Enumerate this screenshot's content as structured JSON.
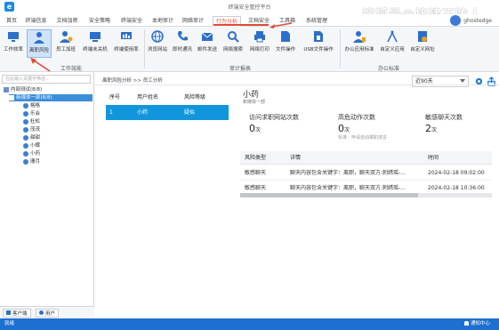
{
  "window": {
    "title": "终端安全管控平台",
    "logo_glyph": "e"
  },
  "watermark": "搜狐号@接建不防人",
  "menu": [
    {
      "label": "首页",
      "active": false
    },
    {
      "label": "终端信息",
      "active": false
    },
    {
      "label": "文档加密",
      "active": false
    },
    {
      "label": "安全策略",
      "active": false
    },
    {
      "label": "终端安全",
      "active": false
    },
    {
      "label": "本地审计",
      "active": false
    },
    {
      "label": "网络审计",
      "active": false
    },
    {
      "label": "行为分析",
      "active": true
    },
    {
      "label": "文档安全",
      "active": false
    },
    {
      "label": "工具箱",
      "active": false
    },
    {
      "label": "系统管理",
      "active": false
    }
  ],
  "user": {
    "name": "ghostedge"
  },
  "ribbon": {
    "groups": [
      {
        "label": "工作效能"
      },
      {
        "label": "审计报表"
      },
      {
        "label": "办公标准"
      }
    ],
    "buttons": [
      {
        "label": "工作效率",
        "icon": "monitor-icon",
        "selected": false
      },
      {
        "label": "离职风险",
        "icon": "person-risk-icon",
        "selected": true
      },
      {
        "label": "员工加班",
        "icon": "overtime-icon",
        "selected": false
      },
      {
        "label": "终端未关机",
        "icon": "terminal-icon",
        "selected": false
      },
      {
        "label": "终端使用率",
        "icon": "usage-icon",
        "selected": false
      },
      {
        "label": "浏览网站",
        "icon": "globe-icon",
        "selected": false
      },
      {
        "label": "即时通讯",
        "icon": "phone-icon",
        "selected": false
      },
      {
        "label": "邮件发送",
        "icon": "mail-icon",
        "selected": false
      },
      {
        "label": "网络搜索",
        "icon": "search-icon",
        "selected": false
      },
      {
        "label": "网络打印",
        "icon": "printer-icon",
        "selected": false
      },
      {
        "label": "文件操作",
        "icon": "file-icon",
        "selected": false
      },
      {
        "label": "USB文件操作",
        "icon": "usb-icon",
        "selected": false
      },
      {
        "label": "办公应用标准",
        "icon": "office-person-icon",
        "selected": false
      },
      {
        "label": "自定义应用",
        "icon": "compass-icon",
        "selected": false
      },
      {
        "label": "自定义网址",
        "icon": "url-icon",
        "selected": false
      }
    ]
  },
  "left_panel": {
    "search_placeholder": "在此输入关键字筛选...",
    "tree": [
      {
        "label": "内部测试(8/8)",
        "level": 0,
        "type": "org"
      },
      {
        "label": "新媒体一部(8/8)",
        "level": 1,
        "type": "dept",
        "selected": true
      },
      {
        "label": "格格",
        "level": 2,
        "type": "user"
      },
      {
        "label": "乐会",
        "level": 2,
        "type": "user"
      },
      {
        "label": "杜松",
        "level": 2,
        "type": "user"
      },
      {
        "label": "茂茂",
        "level": 2,
        "type": "user"
      },
      {
        "label": "甜甜",
        "level": 2,
        "type": "user"
      },
      {
        "label": "小蝶",
        "level": 2,
        "type": "user"
      },
      {
        "label": "小药",
        "level": 2,
        "type": "user"
      },
      {
        "label": "珊月",
        "level": 2,
        "type": "user"
      }
    ],
    "tabs": [
      {
        "label": "客户端"
      },
      {
        "label": "用户"
      }
    ]
  },
  "breadcrumb": "离职风险分析 >> 员工分析",
  "range_select": {
    "value": "近90天"
  },
  "risk_table": {
    "headers": [
      "序号",
      "用户姓名",
      "风险等级"
    ],
    "rows": [
      {
        "index": "1",
        "name": "小药",
        "level": "疑似"
      }
    ]
  },
  "person": {
    "name": "小药",
    "dept": "新媒体一部"
  },
  "stats": [
    {
      "label": "访问求职网站次数",
      "value": "0",
      "unit": "次"
    },
    {
      "label": "高危动作次数",
      "value": "0",
      "unit": "次"
    },
    {
      "label": "敏感聊天次数",
      "value": "2",
      "unit": "次"
    }
  ],
  "stat_note": "标准：申请自动离职流言",
  "detail_table": {
    "headers": [
      "风险类型",
      "详情",
      "时间"
    ],
    "rows": [
      {
        "type": "敏感聊天",
        "detail": "聊天内容包含关键字：离职，聊天双方:刺绣瑶-...",
        "time": "2024-02-18 09:02:00"
      },
      {
        "type": "敏感聊天",
        "detail": "聊天内容包含关键字：离职，聊天双方:刺绣瑶-...",
        "time": "2024-02-18 10:36:00"
      }
    ]
  },
  "statusbar": {
    "left": "就绪",
    "right": "通知中心"
  },
  "colors": {
    "accent": "#1296db",
    "menu_active": "#e65a3d",
    "status_bar": "#1d6fd1",
    "annotation": "#e24a36"
  }
}
